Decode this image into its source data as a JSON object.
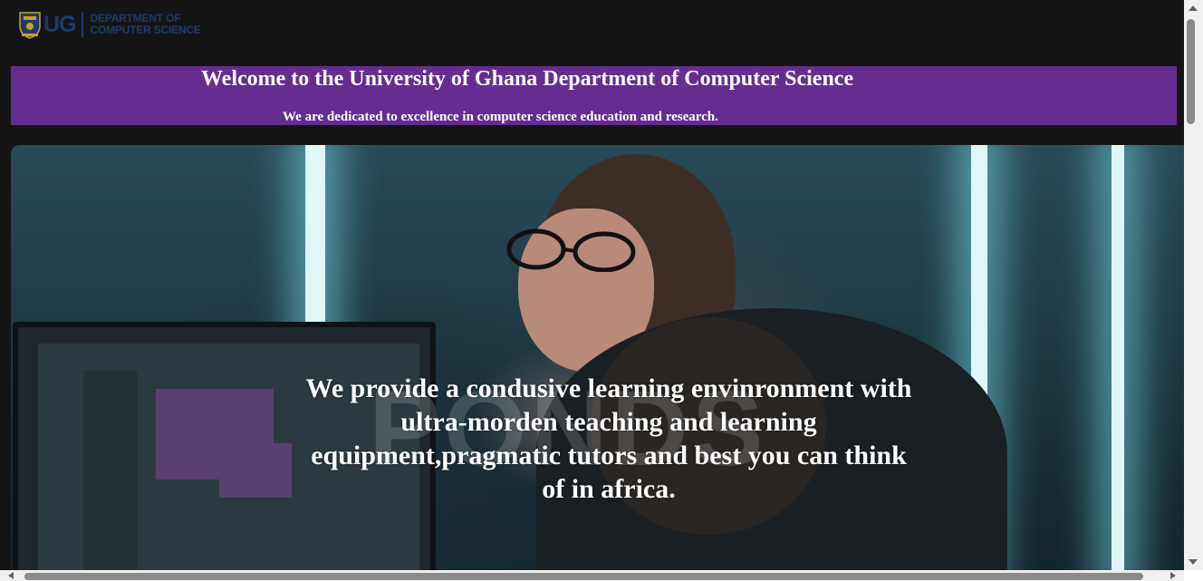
{
  "header": {
    "logo": {
      "mark": "UG",
      "line1": "DEPARTMENT OF",
      "line2": "COMPUTER SCIENCE",
      "crest_icon": "university-crest-icon"
    }
  },
  "banner": {
    "title": "Welcome to the University of Ghana Department of Computer Science",
    "subtitle": "We are dedicated to excellence in computer science education and research.",
    "background_color": "#662d91"
  },
  "hero": {
    "text": "We provide a condusive learning envinronment with ultra-morden teaching and learning equipment,pragmatic tutors and best you can think of in africa.",
    "watermark": "PONDS"
  },
  "scrollbars": {
    "vertical": {
      "position": 0
    },
    "horizontal": {
      "position": 0
    }
  }
}
